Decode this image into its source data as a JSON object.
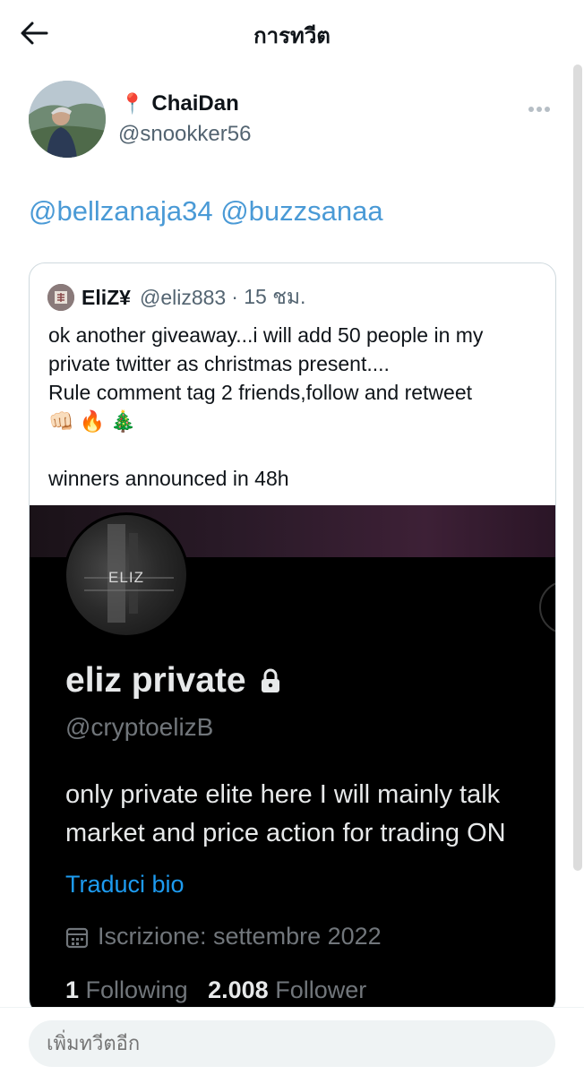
{
  "header": {
    "title": "การทวีต",
    "back_icon": "arrow-left-icon"
  },
  "tweet": {
    "author": {
      "pin_emoji": "📍",
      "name": "ChaiDan",
      "handle": "@snookker56"
    },
    "more_icon": "ellipsis-icon",
    "mentions": [
      "@bellzanaja34",
      "@buzzsanaa"
    ]
  },
  "quoted_tweet": {
    "name": "EliZ¥",
    "handle": "@eliz883",
    "time": "· 15 ชม.",
    "text_lines": [
      "ok another giveaway...i will add 50 people in my",
      "private twitter as christmas present....",
      "Rule comment tag 2 friends,follow and retweet"
    ],
    "emojis": [
      "👊🏻",
      "🔥",
      "🎄"
    ],
    "last_line": "winners announced in 48h",
    "image": {
      "avatar_text": "ELIZ",
      "profile_name": "eliz private",
      "profile_handle": "@cryptoelizB",
      "bio_lines": [
        "only private elite here I will mainly talk",
        "market and price action for trading ON"
      ],
      "translate_label": "Traduci bio",
      "joined": "Iscrizione: settembre 2022",
      "following_count": "1",
      "following_label": "Following",
      "followers_count": "2.008",
      "followers_label": "Follower"
    }
  },
  "reply": {
    "placeholder": "เพิ่มทวีตอีก"
  },
  "colors": {
    "link": "#4a9ad6",
    "text": "#0f1419",
    "muted": "#536471",
    "accent": "#1d9bf0"
  }
}
